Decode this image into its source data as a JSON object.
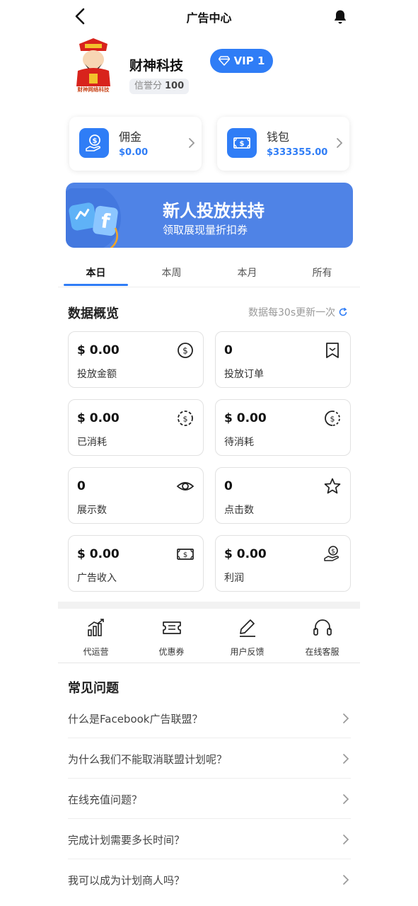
{
  "header": {
    "title": "广告中心",
    "back_icon": "chevron-left-icon",
    "bell_icon": "bell-icon"
  },
  "profile": {
    "company_name": "财神科技",
    "logo_caption": "财神网络科技",
    "credit_label": "信誉分",
    "credit_value": "100",
    "vip_label": "VIP 1"
  },
  "wallet": [
    {
      "label": "佣金",
      "value": "$0.00",
      "icon": "hand-dollar-icon"
    },
    {
      "label": "钱包",
      "value": "$333355.00",
      "icon": "banknote-icon"
    }
  ],
  "banner": {
    "heading": "新人投放扶持",
    "subheading": "领取展现量折扣券"
  },
  "tabs": [
    "本日",
    "本周",
    "本月",
    "所有"
  ],
  "active_tab": 0,
  "overview": {
    "title": "数据概览",
    "refresh_note": "数据每30s更新一次",
    "stats": [
      {
        "value": "$ 0.00",
        "label": "投放金额",
        "icon": "dollar-circle-icon"
      },
      {
        "value": "0",
        "label": "投放订单",
        "icon": "bookmark-icon"
      },
      {
        "value": "$ 0.00",
        "label": "已消耗",
        "icon": "dollar-dashed-icon"
      },
      {
        "value": "$ 0.00",
        "label": "待消耗",
        "icon": "dollar-half-dashed-icon"
      },
      {
        "value": "0",
        "label": "展示数",
        "icon": "eye-icon"
      },
      {
        "value": "0",
        "label": "点击数",
        "icon": "star-icon"
      },
      {
        "value": "$ 0.00",
        "label": "广告收入",
        "icon": "banknote-icon"
      },
      {
        "value": "$ 0.00",
        "label": "利润",
        "icon": "hand-dollar-icon"
      }
    ]
  },
  "tools": [
    {
      "label": "代运营",
      "icon": "bar-chart-icon"
    },
    {
      "label": "优惠券",
      "icon": "ticket-icon"
    },
    {
      "label": "用户反馈",
      "icon": "pen-icon"
    },
    {
      "label": "在线客服",
      "icon": "headset-icon"
    }
  ],
  "faq": {
    "title": "常见问题",
    "items": [
      "什么是Facebook广告联盟？",
      "为什么我们不能取消联盟计划呢？",
      "在线充值问题？",
      "完成计划需要多长时间？",
      "我可以成为计划商人吗？"
    ]
  },
  "colors": {
    "primary": "#2f7df6",
    "banner": "#4f83e6"
  }
}
